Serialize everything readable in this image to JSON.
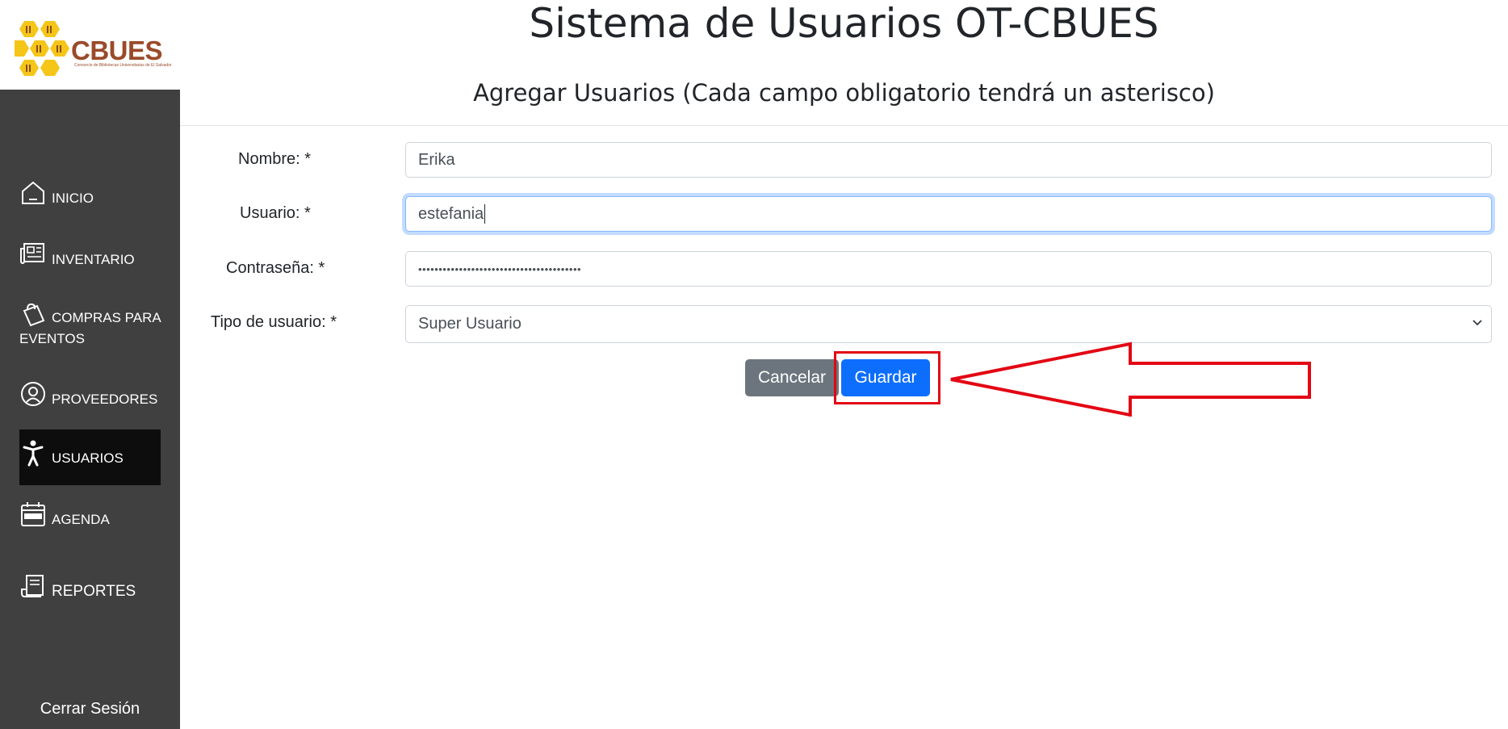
{
  "brand": {
    "name": "CBUES",
    "tagline": "Consorcio de Bibliotecas Universitarias de El Salvador"
  },
  "colors": {
    "sidebar": "#404040",
    "active_item": "#0d0d0d",
    "primary": "#0d6efd",
    "secondary": "#6c757d",
    "annotation": "#e30613"
  },
  "header": {
    "title": "Sistema de Usuarios OT-CBUES",
    "subtitle": "Agregar Usuarios (Cada campo obligatorio tendrá un asterisco)"
  },
  "sidebar": {
    "items": [
      {
        "label": "INICIO",
        "icon": "house-icon"
      },
      {
        "label": "INVENTARIO",
        "icon": "newspaper-icon"
      },
      {
        "label": "COMPRAS PARA EVENTOS",
        "icon": "bag-icon"
      },
      {
        "label": "PROVEEDORES",
        "icon": "person-circle-icon"
      },
      {
        "label": "USUARIOS",
        "icon": "person-icon",
        "active": true
      },
      {
        "label": "AGENDA",
        "icon": "calendar-icon"
      },
      {
        "label": "REPORTES",
        "icon": "receipt-icon"
      }
    ],
    "logout": "Cerrar Sesión"
  },
  "form": {
    "nombre": {
      "label": "Nombre: *",
      "value": "Erika"
    },
    "usuario": {
      "label": "Usuario: *",
      "value": "estefania"
    },
    "password": {
      "label": "Contraseña: *",
      "value": "••••••••••••••••••••••••••••••••••••••••"
    },
    "tipo": {
      "label": "Tipo de usuario: *",
      "value": "Super Usuario"
    },
    "cancel_label": "Cancelar",
    "save_label": "Guardar"
  }
}
